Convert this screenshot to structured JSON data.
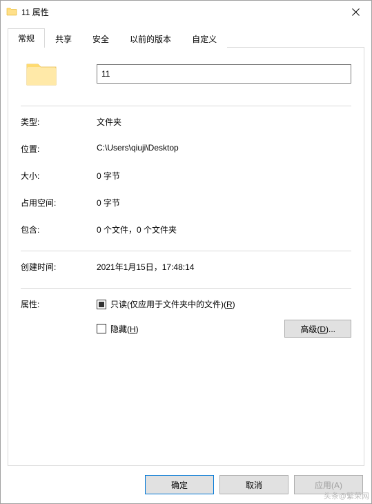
{
  "titlebar": {
    "title": "11 属性"
  },
  "tabs": {
    "general": "常规",
    "sharing": "共享",
    "security": "安全",
    "previous": "以前的版本",
    "custom": "自定义"
  },
  "folder_name": "11",
  "properties": {
    "type_label": "类型:",
    "type_value": "文件夹",
    "location_label": "位置:",
    "location_value": "C:\\Users\\qiuji\\Desktop",
    "size_label": "大小:",
    "size_value": "0 字节",
    "size_on_disk_label": "占用空间:",
    "size_on_disk_value": "0 字节",
    "contains_label": "包含:",
    "contains_value": "0 个文件，0 个文件夹",
    "created_label": "创建时间:",
    "created_value": "2021年1月15日，17:48:14"
  },
  "attributes": {
    "label": "属性:",
    "readonly_label_pre": "只读(仅应用于文件夹中的文件)(",
    "readonly_key": "R",
    "readonly_label_post": ")",
    "hidden_label_pre": "隐藏(",
    "hidden_key": "H",
    "hidden_label_post": ")",
    "advanced_pre": "高级(",
    "advanced_key": "D",
    "advanced_post": ")..."
  },
  "buttons": {
    "ok": "确定",
    "cancel": "取消",
    "apply": "应用(A)"
  },
  "watermark": "头条@繁荣网"
}
